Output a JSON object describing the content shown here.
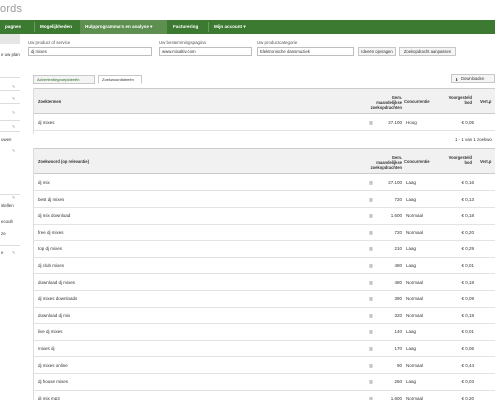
{
  "logo": {
    "text": "ords"
  },
  "nav": {
    "items": [
      {
        "label": "pagnes"
      },
      {
        "label": "Mogelijkheden"
      },
      {
        "label": "Hulpprogramma's en analyse ▾"
      },
      {
        "label": "Facturering"
      },
      {
        "label": "Mijn account ▾"
      }
    ]
  },
  "sidebar": {
    "label_plan": "e uw plan",
    "label_1": "uwen",
    "label_2": "stellen",
    "label_3": "ecoult",
    "label_4": "ze",
    "label_5": "e"
  },
  "form": {
    "product_label": "Uw product of service",
    "product_value": "dj mixes",
    "landing_label": "Uw bestemmingspagina",
    "landing_value": "www.mixaltiv.com",
    "category_label": "Uw productcategorie",
    "category_value": "Elektronische dansmuziek",
    "save_button": "Ideeën opvragen",
    "refine_button": "Zoekopdracht aanpassen"
  },
  "tabs": [
    {
      "label": "Advertentiegroepideeën"
    },
    {
      "label": "Zoekwoordideeën"
    }
  ],
  "download_button": "Downloaden",
  "top_table": {
    "headers": {
      "keyword": "Zoektermen",
      "searches": "Gem. maandelijkse zoekopdrachten",
      "competition": "Concurrentie",
      "bid": "Voorgesteld bod",
      "share": "Vert.p"
    },
    "rows": [
      {
        "keyword": "dj mixes",
        "searches": "27.100",
        "competition": "Hoog",
        "bid": "€ 0,05"
      }
    ]
  },
  "pager": "1 - 1 van 1 zoekwo",
  "table": {
    "headers": {
      "keyword": "Zoekwoord (op relevantie)",
      "searches": "Gem. maandelijkse zoekopdrachten",
      "competition": "Concurrentie",
      "bid": "Voorgesteld bod",
      "share": "Vert.p"
    },
    "rows": [
      {
        "keyword": "dj mix",
        "searches": "27.100",
        "competition": "Laag",
        "bid": "€ 0,16"
      },
      {
        "keyword": "best dj mixes",
        "searches": "720",
        "competition": "Laag",
        "bid": "€ 0,13"
      },
      {
        "keyword": "dj mix download",
        "searches": "1.600",
        "competition": "Normaal",
        "bid": "€ 0,18"
      },
      {
        "keyword": "free dj mixes",
        "searches": "720",
        "competition": "Normaal",
        "bid": "€ 0,20"
      },
      {
        "keyword": "top dj mixes",
        "searches": "210",
        "competition": "Laag",
        "bid": "€ 0,29"
      },
      {
        "keyword": "dj club mixes",
        "searches": "480",
        "competition": "Laag",
        "bid": "€ 0,01"
      },
      {
        "keyword": "download dj mixes",
        "searches": "480",
        "competition": "Normaal",
        "bid": "€ 0,18"
      },
      {
        "keyword": "dj mixes downloads",
        "searches": "390",
        "competition": "Normaal",
        "bid": "€ 0,09"
      },
      {
        "keyword": "download dj mix",
        "searches": "320",
        "competition": "Normaal",
        "bid": "€ 0,18"
      },
      {
        "keyword": "live dj mixes",
        "searches": "140",
        "competition": "Laag",
        "bid": "€ 0,01"
      },
      {
        "keyword": "mixes dj",
        "searches": "170",
        "competition": "Laag",
        "bid": "€ 0,06"
      },
      {
        "keyword": "dj mixes online",
        "searches": "90",
        "competition": "Normaal",
        "bid": "€ 0,44"
      },
      {
        "keyword": "dj house mixes",
        "searches": "260",
        "competition": "Laag",
        "bid": "€ 0,03"
      },
      {
        "keyword": "dj mix mp3",
        "searches": "1.600",
        "competition": "Normaal",
        "bid": "€ 0,20"
      }
    ]
  },
  "colors": {
    "nav_bg": "#3c7a32",
    "nav_active": "#5d8f50",
    "header_bg": "#f1f1f1"
  }
}
